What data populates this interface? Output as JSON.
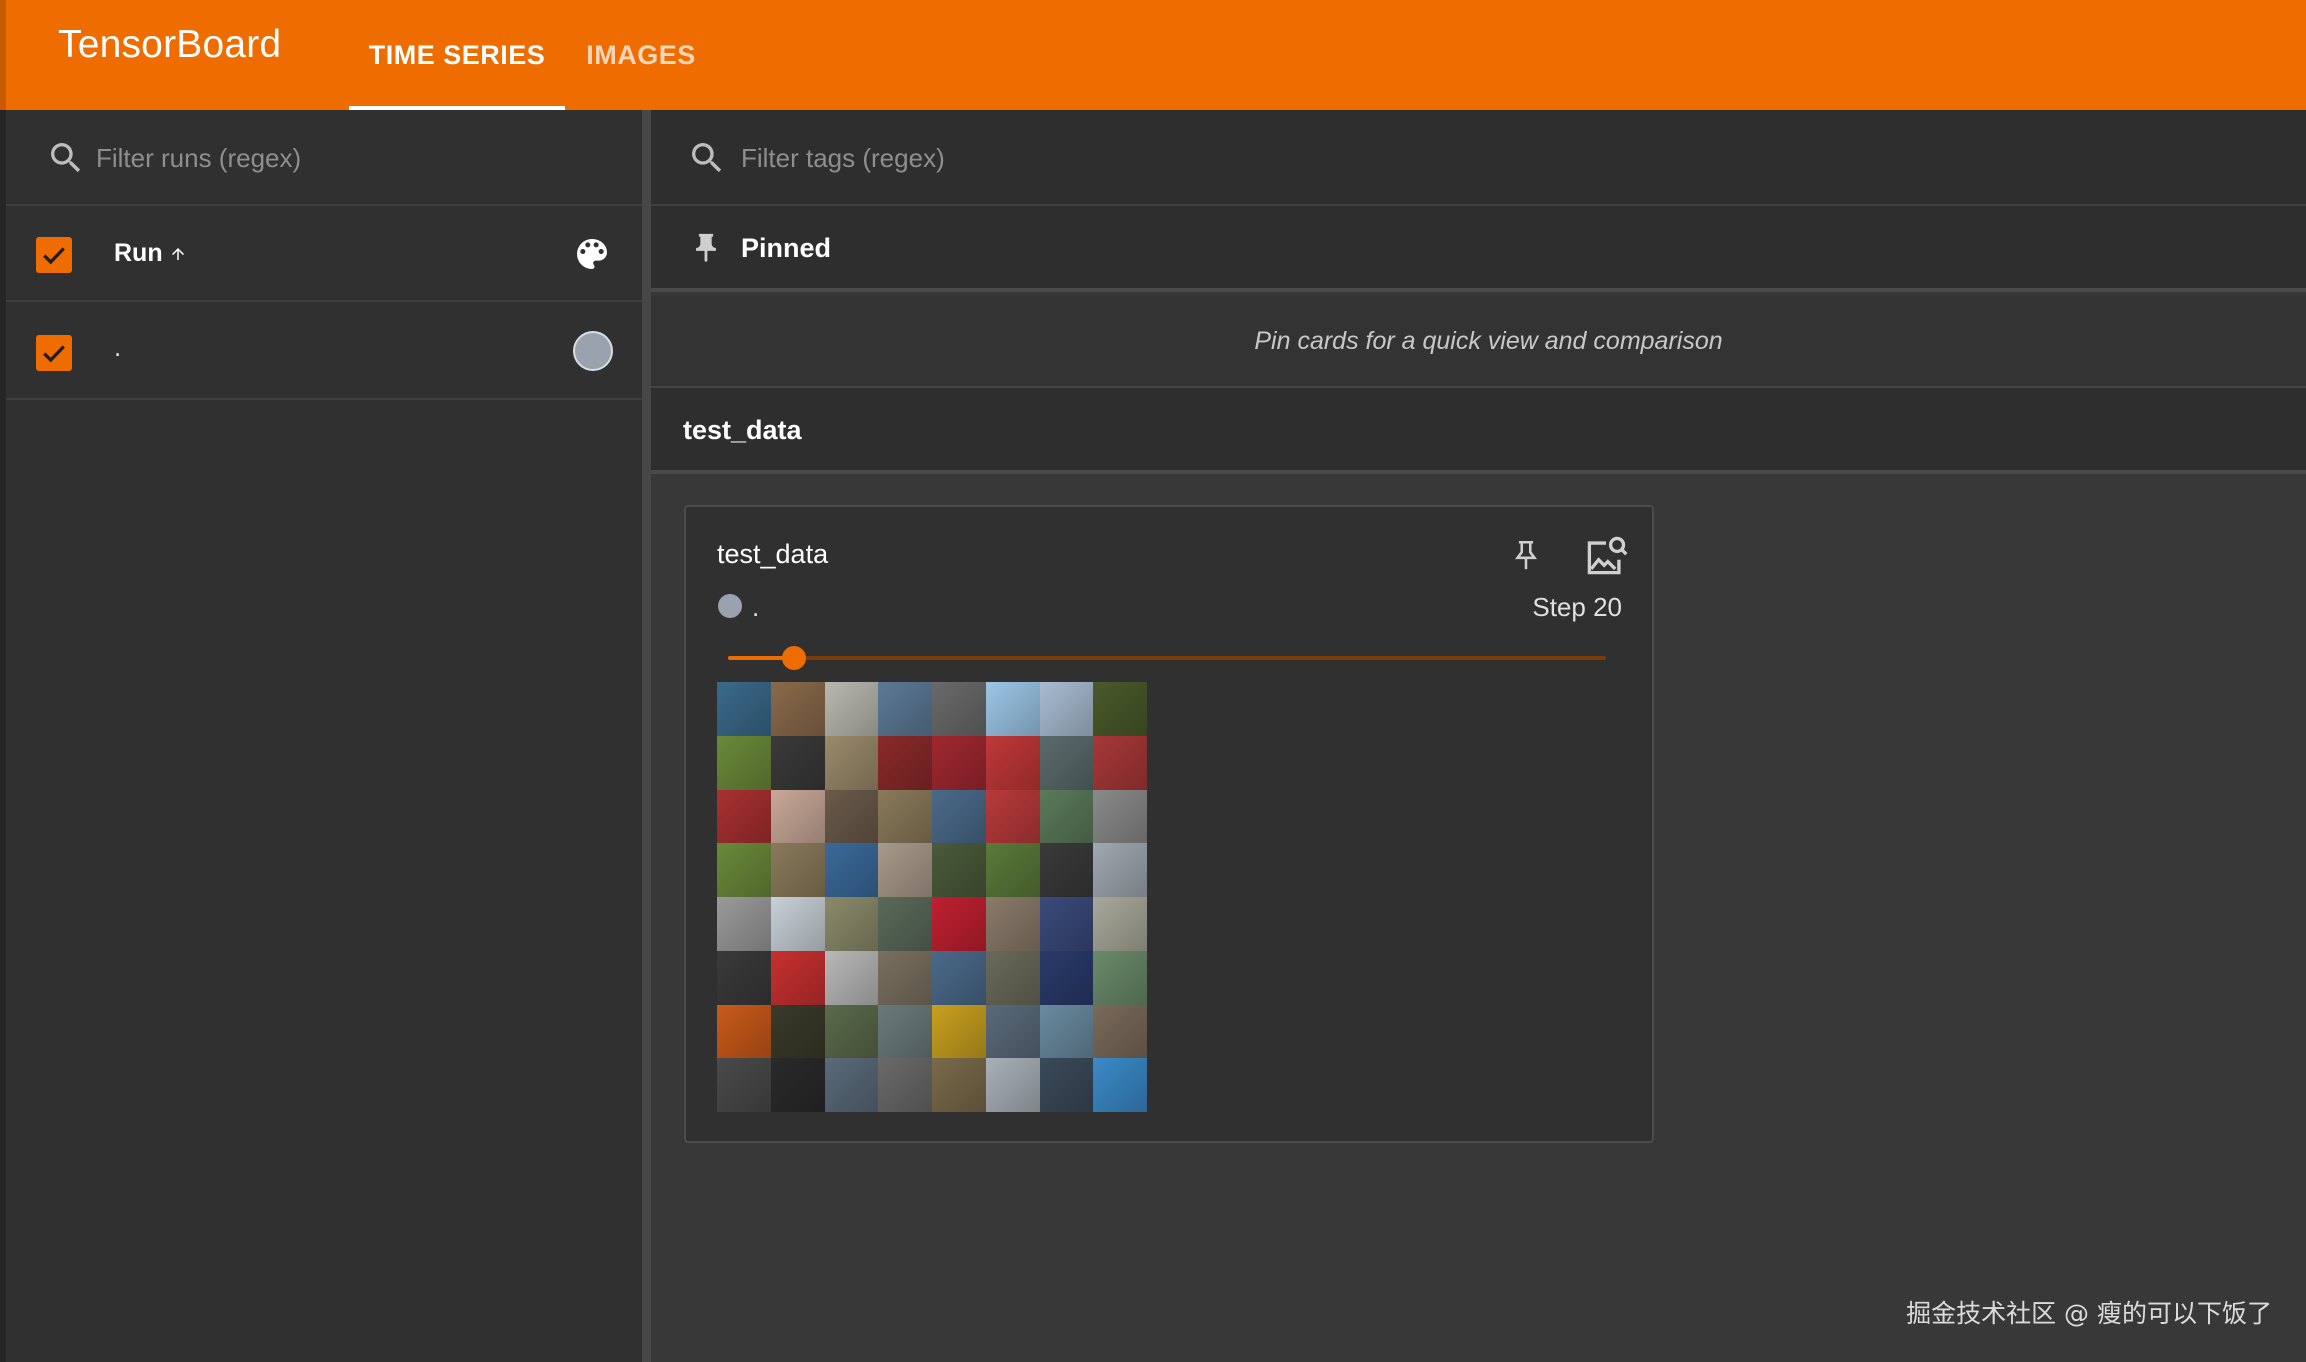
{
  "app": {
    "title": "TensorBoard",
    "tabs": [
      {
        "label": "TIME SERIES",
        "active": true
      },
      {
        "label": "IMAGES",
        "active": false
      }
    ],
    "accent_color": "#ef6c00"
  },
  "sidebar": {
    "filter_placeholder": "Filter runs (regex)",
    "header": {
      "label": "Run",
      "checked": true,
      "sort_icon": "arrow-up-icon",
      "color_icon": "palette-icon"
    },
    "runs": [
      {
        "name": ".",
        "checked": true,
        "color": "#9aa3ad"
      }
    ]
  },
  "main": {
    "filter_placeholder": "Filter tags (regex)",
    "pinned": {
      "title": "Pinned",
      "empty_text": "Pin cards for a quick view and comparison"
    },
    "group": {
      "title": "test_data",
      "card": {
        "title": "test_data",
        "run_name": ".",
        "step_text": "Step 20",
        "slider_fraction": 0.075,
        "icons": [
          "pin-icon",
          "image-search-icon"
        ]
      }
    }
  },
  "watermark": "掘金技术社区 @ 瘦的可以下饭了",
  "thumbnail_colors": [
    "#3a6a8a",
    "#8a6a4a",
    "#b8b8b0",
    "#5c7a96",
    "#6a6a6a",
    "#9cc6e6",
    "#a8bcd0",
    "#4a5a2a",
    "#6a8a3a",
    "#3a3a3a",
    "#9a8a6a",
    "#8a2a2a",
    "#a02830",
    "#c03838",
    "#5a6a6a",
    "#a83838",
    "#a83030",
    "#c8a898",
    "#6a5a4a",
    "#8a7a5a",
    "#4a6a8a",
    "#b83a3a",
    "#5a7a5a",
    "#8a8a8a",
    "#6a8a3a",
    "#8a7a5a",
    "#3a6a9a",
    "#a89a8a",
    "#4a5a3a",
    "#5a7a3a",
    "#3a3a3a",
    "#a0a8b0",
    "#9a9a9a",
    "#c8d0d8",
    "#8a8a6a",
    "#5a6a5a",
    "#c02030",
    "#8a7a6a",
    "#3a4a7a",
    "#a8a89a",
    "#3a3a3a",
    "#c83030",
    "#b8b8b8",
    "#7a7060",
    "#4a6a8a",
    "#6a6a5a",
    "#2a3a6a",
    "#6a8a6a",
    "#c85a1a",
    "#3a3a2a",
    "#5a6a4a",
    "#6a7a7a",
    "#c8a020",
    "#5a6a7a",
    "#6a8aa0",
    "#7a6a5a",
    "#4a4a4a",
    "#2a2a2a",
    "#5a6a7a",
    "#6a6a6a",
    "#7a6a4a",
    "#a8b0b8",
    "#3a4a5a",
    "#3a8ac8"
  ]
}
